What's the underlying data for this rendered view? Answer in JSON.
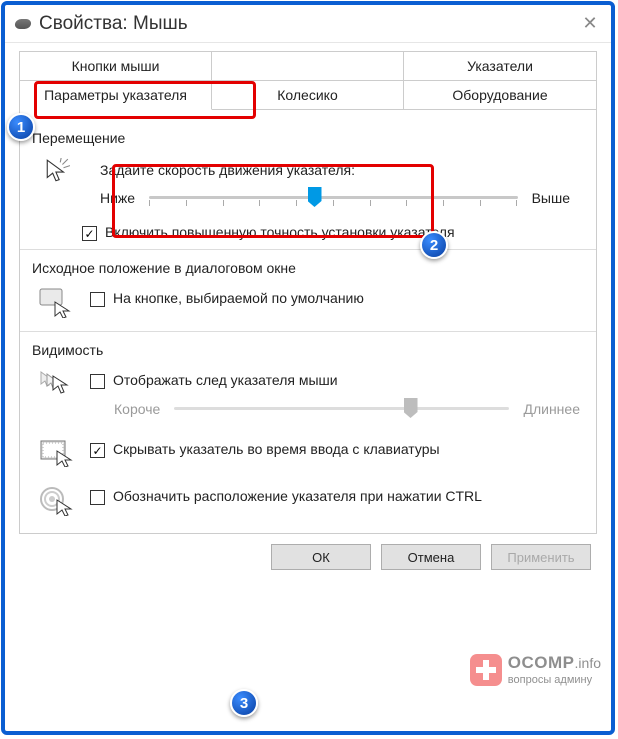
{
  "window": {
    "title": "Свойства: Мышь"
  },
  "tabs": {
    "row1": [
      "Кнопки мыши",
      "",
      "Указатели"
    ],
    "row2": [
      "Параметры указателя",
      "Колесико",
      "Оборудование"
    ],
    "active": "Параметры указателя"
  },
  "motion": {
    "group_label": "Перемещение",
    "speed_label": "Задайте скорость движения указателя:",
    "lower": "Ниже",
    "higher": "Выше",
    "slider_pos_pct": 45,
    "precision_check": {
      "checked": true,
      "label": "Включить повышенную точность установки указателя"
    }
  },
  "snap": {
    "group_label": "Исходное положение в диалоговом окне",
    "snap_check": {
      "checked": false,
      "label": "На кнопке, выбираемой по умолчанию"
    }
  },
  "visibility": {
    "group_label": "Видимость",
    "trail_check": {
      "checked": false,
      "label": "Отображать след указателя мыши"
    },
    "trail_lower": "Короче",
    "trail_higher": "Длиннее",
    "trail_pos_pct": 70,
    "hide_check": {
      "checked": true,
      "label": "Скрывать указатель во время ввода с клавиатуры"
    },
    "locate_check": {
      "checked": false,
      "label": "Обозначить расположение указателя при нажатии CTRL"
    }
  },
  "buttons": {
    "ok": "ОК",
    "cancel": "Отмена",
    "apply": "Применить"
  },
  "annotations": {
    "n1": "1",
    "n2": "2",
    "n3": "3"
  },
  "watermark": {
    "brand": "OCOMP",
    "tld": ".info",
    "sub": "вопросы админу"
  }
}
